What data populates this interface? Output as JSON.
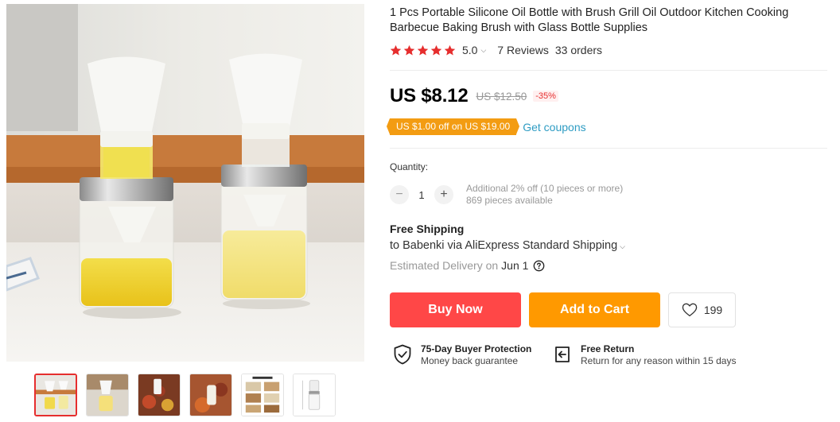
{
  "product": {
    "title": "1 Pcs Portable Silicone Oil Bottle with Brush Grill Oil Outdoor Kitchen Cooking Barbecue Baking Brush with Glass Bottle Supplies"
  },
  "rating": {
    "score": "5.0",
    "stars": 5,
    "reviews": "7 Reviews",
    "orders": "33 orders"
  },
  "price": {
    "current": "US $8.12",
    "original": "US $12.50",
    "discount": "-35%"
  },
  "coupon": {
    "badge": "US $1.00 off on US $19.00",
    "link": "Get coupons"
  },
  "quantity": {
    "label": "Quantity:",
    "minus": "−",
    "value": "1",
    "plus": "+",
    "additional": "Additional 2% off (10 pieces or more)",
    "available": "869 pieces available"
  },
  "shipping": {
    "title": "Free Shipping",
    "destination": "to Babenki via AliExpress Standard Shipping",
    "estimated_label": "Estimated Delivery on",
    "date": "Jun 1"
  },
  "actions": {
    "buy_now": "Buy Now",
    "add_to_cart": "Add to Cart",
    "wishlist_count": "199"
  },
  "guarantees": [
    {
      "title": "75-Day Buyer Protection",
      "subtitle": "Money back guarantee",
      "icon": "shield-check-icon"
    },
    {
      "title": "Free Return",
      "subtitle": "Return for any reason within 15 days",
      "icon": "return-arrow-icon"
    }
  ],
  "colors": {
    "accent_red": "#ff4747",
    "cart_orange": "#ff9900",
    "coupon_orange": "#f39c12",
    "link_blue": "#2e9cc3",
    "star_red": "#e62e2e"
  },
  "gallery": {
    "thumbnail_count": 6,
    "active_index": 0
  }
}
